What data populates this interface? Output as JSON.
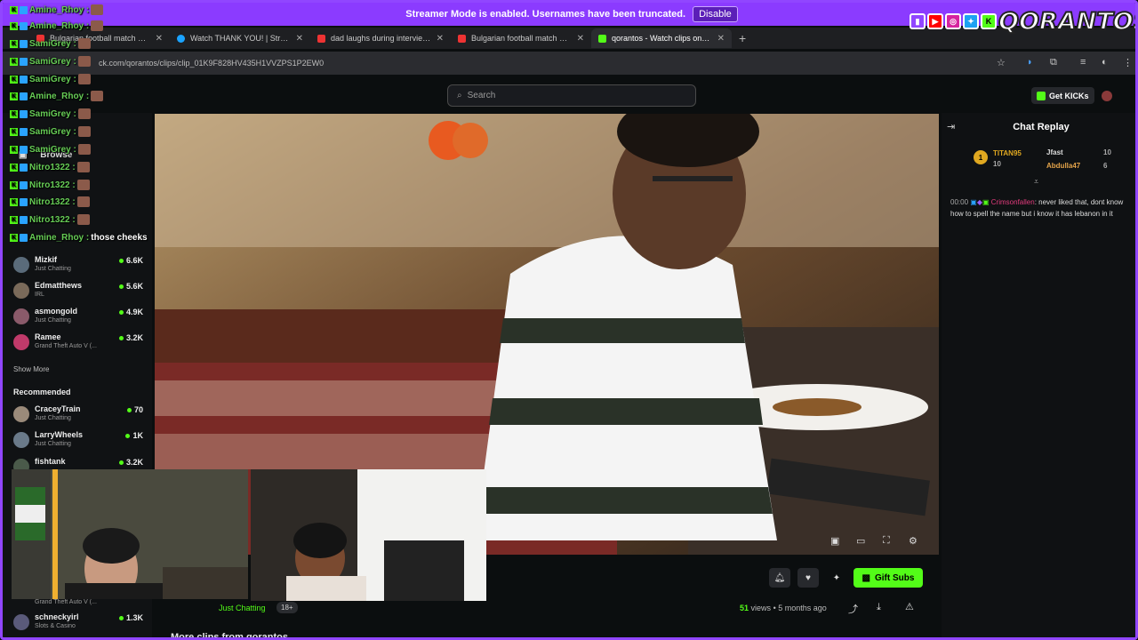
{
  "banner": {
    "text": "Streamer Mode is enabled. Usernames have been truncated.",
    "button": "Disable"
  },
  "logo": {
    "text": "QORANTOS"
  },
  "tabs": [
    {
      "title": "Bulgarian football match aband",
      "fav": "#e33"
    },
    {
      "title": "Watch THANK YOU! | Streamab",
      "fav": "#1aa3ff"
    },
    {
      "title": "dad laughs during interview - Y",
      "fav": "#e33"
    },
    {
      "title": "Bulgarian football match aband",
      "fav": "#e33"
    },
    {
      "title": "qorantos - Watch clips on Kick",
      "fav": "#53fc18"
    }
  ],
  "address": {
    "url": "ck.com/qorantos/clips/clip_01K9F828HV435H1VVZPS1P2EW0"
  },
  "header": {
    "search_placeholder": "Search",
    "get_kicks": "Get KICKs"
  },
  "overlay_chat": [
    {
      "name": "Amine_Rhoy :",
      "msg": ""
    },
    {
      "name": "Amine_Rhoy :",
      "msg": ""
    },
    {
      "name": "SamiGrey :",
      "msg": ""
    },
    {
      "name": "SamiGrey :",
      "msg": ""
    },
    {
      "name": "SamiGrey :",
      "msg": ""
    },
    {
      "name": "Amine_Rhoy :",
      "msg": ""
    },
    {
      "name": "SamiGrey :",
      "msg": ""
    },
    {
      "name": "SamiGrey :",
      "msg": ""
    },
    {
      "name": "SamiGrey :",
      "msg": ""
    },
    {
      "name": "Nitro1322 :",
      "msg": ""
    },
    {
      "name": "Nitro1322 :",
      "msg": ""
    },
    {
      "name": "Nitro1322 :",
      "msg": ""
    },
    {
      "name": "Nitro1322 :",
      "msg": ""
    },
    {
      "name": "Amine_Rhoy :",
      "msg": "those cheeks"
    }
  ],
  "sidebar": {
    "browse": "Browse",
    "channels": [
      {
        "name": "Mizkif",
        "category": "Just Chatting",
        "count": "6.6K"
      },
      {
        "name": "Edmatthews",
        "category": "IRL",
        "count": "5.6K"
      },
      {
        "name": "asmongold",
        "category": "Just Chatting",
        "count": "4.9K"
      },
      {
        "name": "Ramee",
        "category": "Grand Theft Auto V (...",
        "count": "3.2K"
      }
    ],
    "show_more": "Show More",
    "recommended_heading": "Recommended",
    "recommended": [
      {
        "name": "CraceyTrain",
        "category": "Just Chatting",
        "count": "70"
      },
      {
        "name": "LarryWheels",
        "category": "Just Chatting",
        "count": "1K"
      },
      {
        "name": "fishtank",
        "category": "",
        "count": "3.2K"
      }
    ],
    "bottom": {
      "name": "schneckyirl",
      "category": "Slots & Casino",
      "count": "1.3K",
      "upper_category": "Grand Theft Auto V (..."
    }
  },
  "chat_replay": {
    "title": "Chat Replay",
    "gifters": [
      {
        "rank": "1",
        "name": "TITAN95",
        "count": "10"
      },
      {
        "name": "Jfast",
        "count": "10"
      },
      {
        "name": "Abdulla47",
        "count": "6"
      }
    ],
    "message": {
      "time": "00:00",
      "user": "Crimsonfallen",
      "text": ": never liked that, dont know how to spell the name but i know it has lebanon in it"
    }
  },
  "stream_info": {
    "category": "Just Chatting",
    "age": "18+"
  },
  "actions": {
    "gift_subs": "Gift Subs"
  },
  "clip_meta": {
    "views_count": "51",
    "views_label": "views",
    "age": "• 5 months ago"
  },
  "more_clips": "More clips from qorantos",
  "colors": {
    "kick_green": "#53fc18",
    "twitch_purple": "#8b3bff"
  }
}
